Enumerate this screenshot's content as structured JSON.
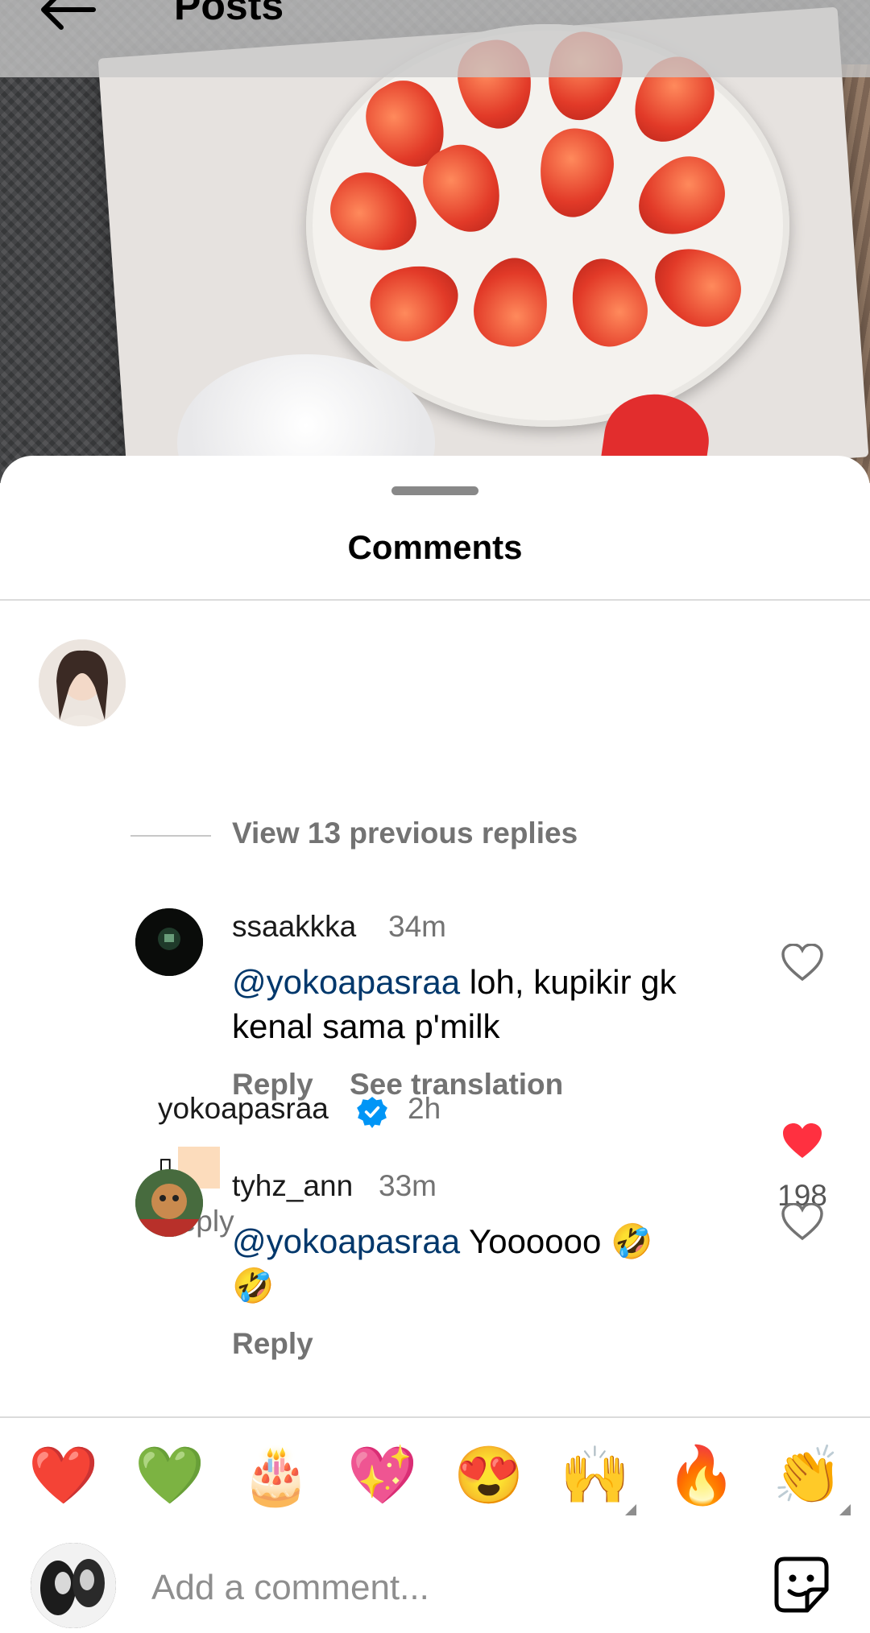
{
  "header": {
    "title": "Posts",
    "back_icon": "arrow-left-icon"
  },
  "comments_sheet": {
    "title": "Comments"
  },
  "comment_main": {
    "username": "yokoapasraa",
    "verified": true,
    "time": "2h",
    "body_glyph": "▯",
    "reply_label": "Reply",
    "likes": "198",
    "liked": true,
    "like_color": "#ff3040"
  },
  "view_replies_label": "View 13 previous replies",
  "replies": [
    {
      "username": "ssaakkka",
      "time": "34m",
      "mention": "@yokoapasraa",
      "text_line1": " loh, kupikir gk",
      "text_line2": "kenal sama p'milk",
      "reply_label": "Reply",
      "translate_label": "See translation"
    },
    {
      "username": "tyhz_ann",
      "time": "33m",
      "mention": "@yokoapasraa",
      "text_line1": " Yoooooo 🤣",
      "text_line2": "🤣",
      "reply_label": "Reply"
    }
  ],
  "emoji_bar": [
    "❤️",
    "💚",
    "🎂",
    "💖",
    "😍",
    "🙌",
    "🔥",
    "👏"
  ],
  "composer": {
    "placeholder": "Add a comment...",
    "sticker_icon": "sticker-smiley-icon"
  },
  "colors": {
    "mention": "#00376b",
    "secondary_text": "#737373",
    "verified_blue": "#0095f6"
  }
}
